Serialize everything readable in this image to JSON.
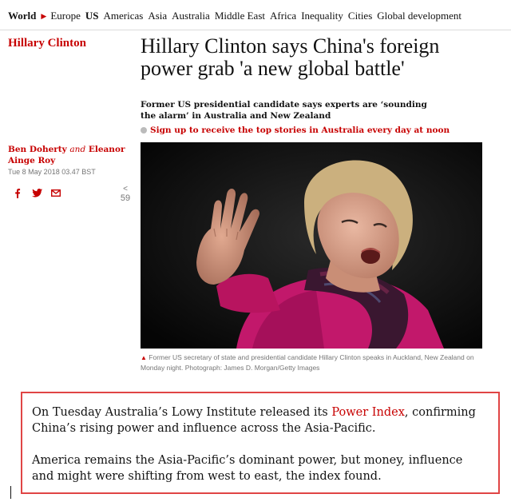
{
  "nav": {
    "items": [
      "World",
      "Europe",
      "US",
      "Americas",
      "Asia",
      "Australia",
      "Middle East",
      "Africa",
      "Inequality",
      "Cities",
      "Global development"
    ]
  },
  "article": {
    "tag": "Hillary Clinton",
    "headline": "Hillary Clinton says China's foreign power grab 'a new global battle'",
    "standfirst": "Former US presidential candidate says experts are ‘sounding the alarm’ in Australia and New Zealand",
    "signup": "Sign up to receive the top stories in Australia every day at noon",
    "byline_author1": "Ben Doherty",
    "byline_and": "and",
    "byline_author2": "Eleanor Ainge Roy",
    "date": "Tue 8 May 2018 03.47 BST",
    "comments_count": "59",
    "caption": "Former US secretary of state and presidential candidate Hillary Clinton speaks in Auckland, New Zealand on Monday night. Photograph: James D. Morgan/Getty Images"
  },
  "excerpt": {
    "para1_before": "On Tuesday Australia’s Lowy Institute released its ",
    "para1_link": "Power Index",
    "para1_after": ", confirming China’s rising power and influence across the Asia-Pacific.",
    "para2": "America remains the Asia-Pacific’s dominant power, but money, influence and might were shifting from west to east, the index found."
  },
  "colors": {
    "accent": "#c70000",
    "highlight_border": "#e04545",
    "jacket": "#c2186b"
  },
  "icons": [
    "facebook-icon",
    "twitter-icon",
    "email-icon",
    "comment-icon",
    "caption-triangle-icon"
  ]
}
